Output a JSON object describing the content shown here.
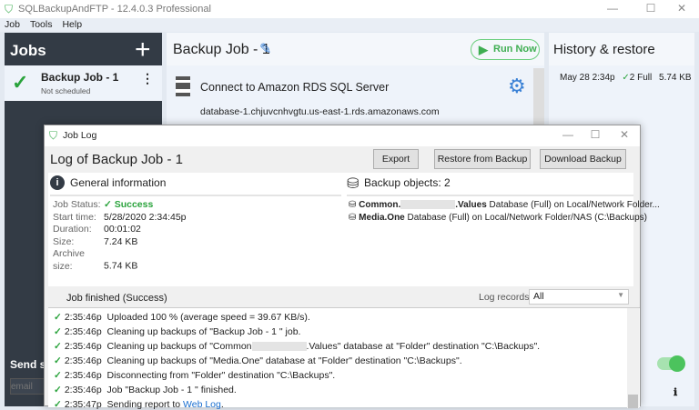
{
  "app": {
    "title": "SQLBackupAndFTP - 12.4.0.3 Professional",
    "menu": [
      "Job",
      "Tools",
      "Help"
    ]
  },
  "jobs": {
    "title": "Jobs",
    "add_icon": "plus-icon",
    "items": [
      {
        "name": "Backup Job - 1",
        "schedule": "Not scheduled"
      }
    ],
    "send_label": "Send se",
    "email_placeholder": "email"
  },
  "job": {
    "title": "Backup Job - 1",
    "run_now": "Run Now",
    "step": {
      "title": "Connect to Amazon RDS SQL Server",
      "server": "database-1.chjuvcnhvgtu.us-east-1.rds.amazonaws.com"
    }
  },
  "history": {
    "title": "History & restore",
    "rows": [
      {
        "date": "May 28 2:34p",
        "count": "2 Full",
        "size": "5.74 KB"
      }
    ]
  },
  "dialog": {
    "title": "Job Log",
    "heading_prefix": "Log of",
    "heading_job": "Backup Job - 1",
    "buttons": {
      "export": "Export",
      "restore": "Restore from Backup",
      "download": "Download Backup"
    },
    "general": {
      "title": "General information",
      "fields": [
        {
          "label": "Job Status:",
          "value": "✓ Success"
        },
        {
          "label": "Start time:",
          "value": "5/28/2020 2:34:45p"
        },
        {
          "label": "Duration:",
          "value": "00:01:02"
        },
        {
          "label": "Size:",
          "value": "7.24 KB"
        },
        {
          "label": "Archive size:",
          "value": "5.74 KB"
        }
      ]
    },
    "objects": {
      "title": "Backup objects: 2",
      "items": [
        {
          "name_a": "Common.",
          "name_b": ".Values",
          "desc": "Database (Full) on Local/Network Folder..."
        },
        {
          "name": "Media.One",
          "desc": "Database (Full) on Local/Network Folder/NAS (C:\\Backups)"
        }
      ]
    },
    "log": {
      "status": "Job finished (Success)",
      "filter_label": "Log records",
      "filter_value": "All",
      "rows": [
        {
          "time": "2:35:46p",
          "text": "Uploaded 100 % (average speed = 39.67 KB/s)."
        },
        {
          "time": "2:35:46p",
          "text": "Cleaning up backups of \"Backup Job - 1 \" job."
        },
        {
          "time": "2:35:46p",
          "text_a": "Cleaning up backups of \"Common",
          "text_b": ".Values\" database at \"Folder\" destination \"C:\\Backups\"."
        },
        {
          "time": "2:35:46p",
          "text": "Cleaning up backups of \"Media.One\" database at \"Folder\" destination \"C:\\Backups\"."
        },
        {
          "time": "2:35:46p",
          "text": "Disconnecting from \"Folder\" destination \"C:\\Backups\"."
        },
        {
          "time": "2:35:46p",
          "text": "Job \"Backup Job - 1 \" finished."
        },
        {
          "time": "2:35:47p",
          "text": "Sending report to",
          "link": "Web Log",
          "end": "."
        }
      ]
    }
  },
  "colors": {
    "accent_green": "#3fae52",
    "accent_blue": "#3b82d6",
    "sidebar": "#333b45"
  }
}
